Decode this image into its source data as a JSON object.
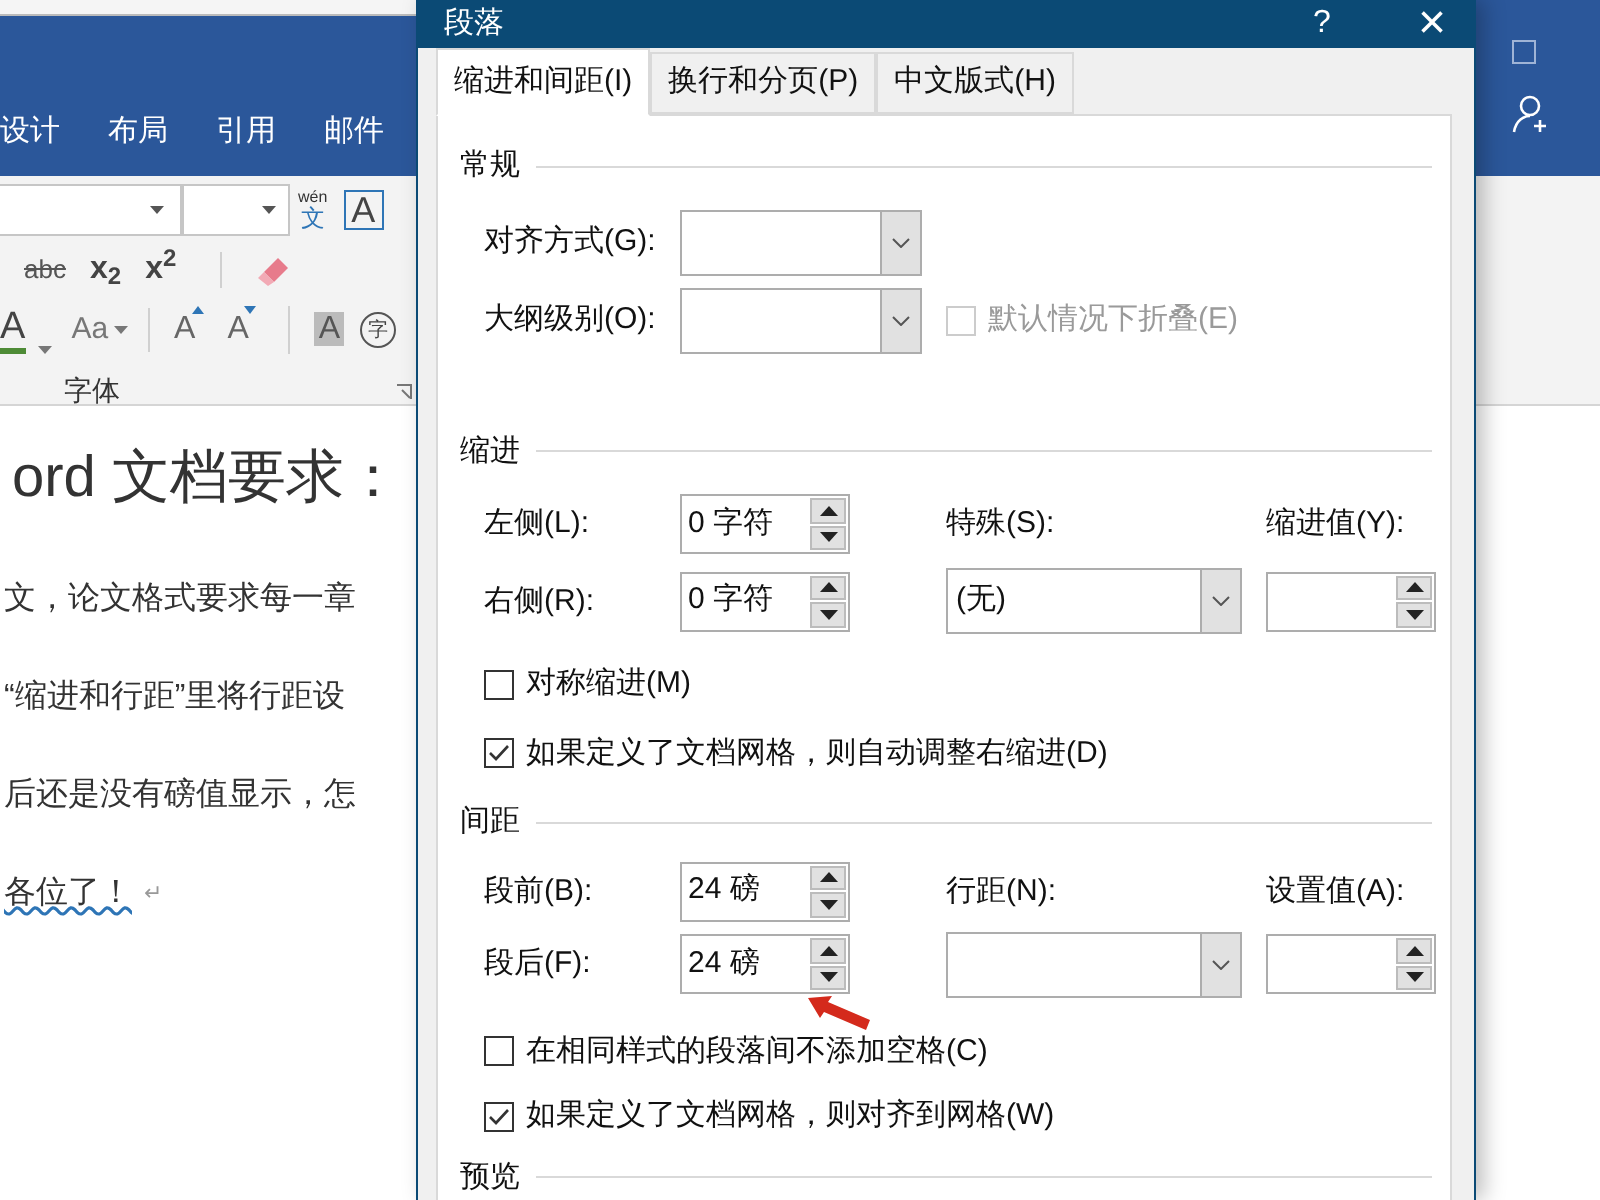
{
  "word": {
    "ribbon_tabs": [
      {
        "label": "设计"
      },
      {
        "label": "布局"
      },
      {
        "label": "引用"
      },
      {
        "label": "邮件"
      }
    ],
    "tool_rows": [
      [
        {
          "kind": "font-box"
        },
        {
          "kind": "size-box"
        },
        {
          "kind": "phonetic",
          "label": "wén",
          "sub": "文"
        },
        {
          "kind": "bordered",
          "label": "A"
        }
      ],
      [
        {
          "kind": "strike",
          "label": "abc"
        },
        {
          "kind": "script",
          "label": "x$_{2}$"
        },
        {
          "kind": "script",
          "label": "x$^{2}$"
        },
        {
          "kind": "eraser"
        }
      ],
      [
        {
          "kind": "color",
          "label": "A"
        },
        {
          "kind": "case",
          "label": "Aa"
        },
        {
          "kind": "grow",
          "label": "A"
        },
        {
          "kind": "shrink",
          "label": "A"
        },
        {
          "kind": "shaded",
          "label": "A"
        },
        {
          "kind": "circled",
          "label": "字"
        }
      ]
    ],
    "group_label": "字体",
    "document": {
      "heading": "ord 文档要求：",
      "lines": [
        "文，论文格式要求每一章",
        "“缩进和行距”里将行距设",
        "后还是没有磅值显示，怎"
      ],
      "last_line": "各位了！",
      "paragraph_mark": "↵"
    }
  },
  "dialog": {
    "title": "段落",
    "help": "?",
    "close": "×",
    "tabs": [
      {
        "label": "缩进和间距(I)",
        "selected": true
      },
      {
        "label": "换行和分页(P)",
        "selected": false
      },
      {
        "label": "中文版式(H)",
        "selected": false
      }
    ],
    "general": {
      "heading": "常规",
      "alignment": {
        "label": "对齐方式(G):"
      },
      "outline": {
        "label": "大纲级别(O):"
      },
      "collapse": {
        "label": "默认情况下折叠(E)",
        "checked": false,
        "disabled": true
      }
    },
    "indent": {
      "heading": "缩进",
      "left": {
        "label": "左侧(L):",
        "value": "0 字符"
      },
      "right": {
        "label": "右侧(R):",
        "value": "0 字符"
      },
      "special": {
        "label": "特殊(S):",
        "value": "(无)"
      },
      "by": {
        "label": "缩进值(Y):"
      },
      "options": [
        {
          "label": "对称缩进(M)",
          "checked": false
        },
        {
          "label": "如果定义了文档网格，则自动调整右缩进(D)",
          "checked": true
        }
      ]
    },
    "spacing": {
      "heading": "间距",
      "before": {
        "label": "段前(B):",
        "value": "24 磅"
      },
      "after": {
        "label": "段后(F):",
        "value": "24 磅"
      },
      "line": {
        "label": "行距(N):"
      },
      "at": {
        "label": "设置值(A):"
      },
      "options": [
        {
          "label": "在相同样式的段落间不添加空格(C)",
          "checked": false
        },
        {
          "label": "如果定义了文档网格，则对齐到网格(W)",
          "checked": true
        }
      ]
    },
    "preview": {
      "heading": "预览"
    }
  }
}
